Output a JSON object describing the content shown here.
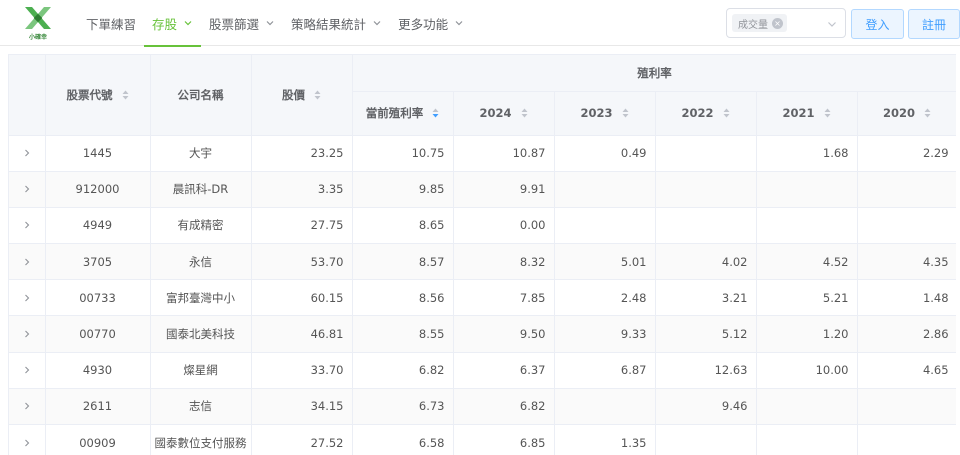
{
  "header": {
    "brand": "小確幸",
    "nav": [
      {
        "label": "下單練習",
        "has_menu": false,
        "active": false
      },
      {
        "label": "存股",
        "has_menu": true,
        "active": true
      },
      {
        "label": "股票篩選",
        "has_menu": true,
        "active": false
      },
      {
        "label": "策略結果統計",
        "has_menu": true,
        "active": false
      },
      {
        "label": "更多功能",
        "has_menu": true,
        "active": false
      }
    ],
    "select_tag": "成交量",
    "login_label": "登入",
    "register_label": "註冊",
    "accent_color": "#67c23a",
    "button_color": "#409eff"
  },
  "table": {
    "group_header": "殖利率",
    "columns": {
      "code": "股票代號",
      "name": "公司名稱",
      "price": "股價",
      "current": "當前殖利率",
      "y2024": "2024",
      "y2023": "2023",
      "y2022": "2022",
      "y2021": "2021",
      "y2020": "2020"
    },
    "rows": [
      {
        "code": "1445",
        "name": "大宇",
        "price": "23.25",
        "current": "10.75",
        "y2024": "10.87",
        "y2023": "0.49",
        "y2022": "",
        "y2021": "1.68",
        "y2020": "2.29"
      },
      {
        "code": "912000",
        "name": "晨訊科-DR",
        "price": "3.35",
        "current": "9.85",
        "y2024": "9.91",
        "y2023": "",
        "y2022": "",
        "y2021": "",
        "y2020": ""
      },
      {
        "code": "4949",
        "name": "有成精密",
        "price": "27.75",
        "current": "8.65",
        "y2024": "0.00",
        "y2023": "",
        "y2022": "",
        "y2021": "",
        "y2020": ""
      },
      {
        "code": "3705",
        "name": "永信",
        "price": "53.70",
        "current": "8.57",
        "y2024": "8.32",
        "y2023": "5.01",
        "y2022": "4.02",
        "y2021": "4.52",
        "y2020": "4.35"
      },
      {
        "code": "00733",
        "name": "富邦臺灣中小",
        "price": "60.15",
        "current": "8.56",
        "y2024": "7.85",
        "y2023": "2.48",
        "y2022": "3.21",
        "y2021": "5.21",
        "y2020": "1.48"
      },
      {
        "code": "00770",
        "name": "國泰北美科技",
        "price": "46.81",
        "current": "8.55",
        "y2024": "9.50",
        "y2023": "9.33",
        "y2022": "5.12",
        "y2021": "1.20",
        "y2020": "2.86"
      },
      {
        "code": "4930",
        "name": "燦星網",
        "price": "33.70",
        "current": "6.82",
        "y2024": "6.37",
        "y2023": "6.87",
        "y2022": "12.63",
        "y2021": "10.00",
        "y2020": "4.65"
      },
      {
        "code": "2611",
        "name": "志信",
        "price": "34.15",
        "current": "6.73",
        "y2024": "6.82",
        "y2023": "",
        "y2022": "9.46",
        "y2021": "",
        "y2020": ""
      },
      {
        "code": "00909",
        "name": "國泰數位支付服務",
        "price": "27.52",
        "current": "6.58",
        "y2024": "6.85",
        "y2023": "1.35",
        "y2022": "",
        "y2021": "",
        "y2020": ""
      }
    ]
  }
}
